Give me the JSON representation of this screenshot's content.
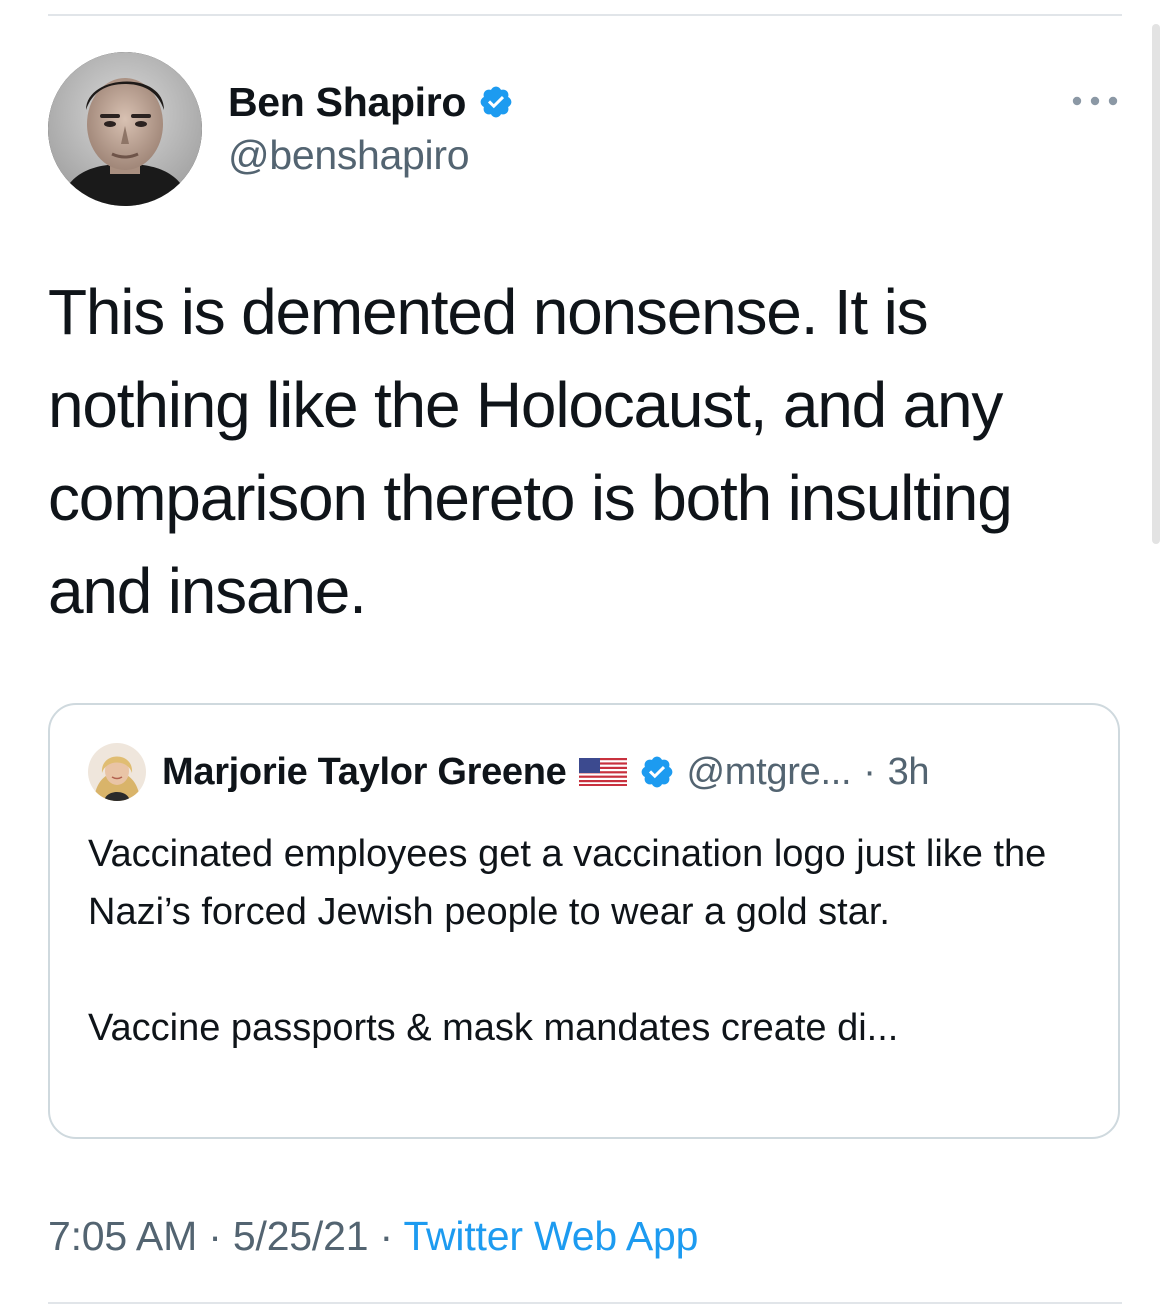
{
  "tweet": {
    "author": {
      "name": "Ben Shapiro",
      "handle": "@benshapiro",
      "verified": true
    },
    "text": "This is demented nonsense. It is nothing like the Holocaust, and any comparison thereto is both insulting and insane.",
    "more_icon": "more-horizontal-icon",
    "quoted": {
      "author": {
        "name": "Marjorie Taylor Greene",
        "flag": "us-flag-icon",
        "verified": true,
        "handle": "@mtgre...",
        "separator": "·",
        "time": "3h"
      },
      "paragraphs": [
        "Vaccinated employees get a vaccination logo just like the Nazi’s forced Jewish people to wear a gold star.",
        "Vaccine passports & mask mandates create di..."
      ]
    },
    "footer": {
      "time": "7:05 AM",
      "separator": "·",
      "date": "5/25/21",
      "source": "Twitter Web App"
    }
  },
  "colors": {
    "verified_blue": "#1d9bf0",
    "secondary_text": "#536471",
    "border": "#cfd9de",
    "text": "#0f1419"
  }
}
